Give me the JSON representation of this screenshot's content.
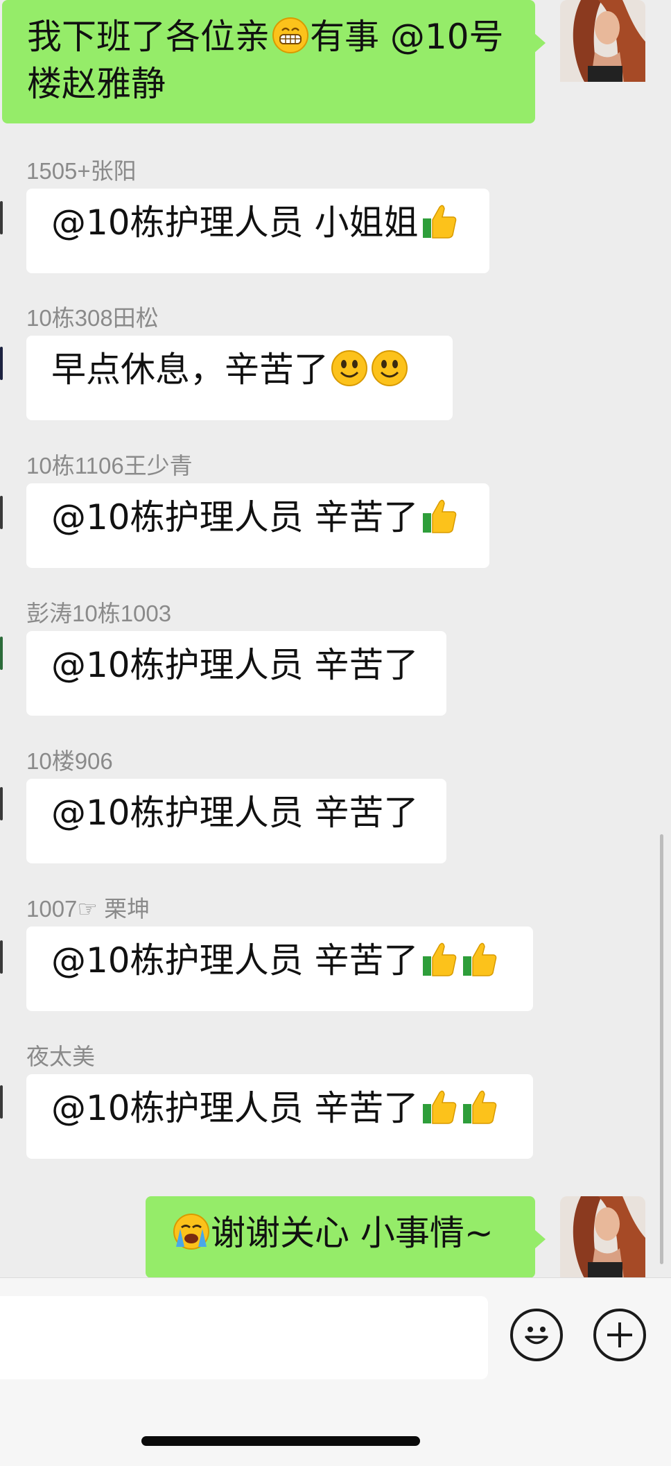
{
  "messages": [
    {
      "side": "out",
      "text": "我下班了各位亲",
      "emoji": "grinning-face",
      "text2": "有事 @10号",
      "line2": "楼赵雅静"
    },
    {
      "side": "in",
      "sender": "1505+张阳",
      "text": "@10栋护理人员 小姐姐",
      "emojis": [
        "thumbs-up"
      ]
    },
    {
      "side": "in",
      "sender": "10栋308田松",
      "text": "早点休息，辛苦了",
      "emojis": [
        "smiley",
        "smiley"
      ]
    },
    {
      "side": "in",
      "sender": "10栋1106王少青",
      "text": "@10栋护理人员 辛苦了",
      "emojis": [
        "thumbs-up"
      ]
    },
    {
      "side": "in",
      "sender": "彭涛10栋1003",
      "text": "@10栋护理人员 辛苦了",
      "emojis": []
    },
    {
      "side": "in",
      "sender": "10楼906",
      "text": "@10栋护理人员 辛苦了",
      "emojis": []
    },
    {
      "side": "in",
      "sender": "1007☞ 栗坤",
      "text": "@10栋护理人员 辛苦了",
      "emojis": [
        "thumbs-up",
        "thumbs-up"
      ]
    },
    {
      "side": "in",
      "sender": "夜太美",
      "text": "@10栋护理人员 辛苦了",
      "emojis": [
        "thumbs-up",
        "thumbs-up"
      ]
    },
    {
      "side": "out",
      "emoji": "loudly-crying-face",
      "text": "谢谢关心 小事情~"
    }
  ],
  "colors": {
    "out_bubble": "#95ec69",
    "in_bubble": "#ffffff",
    "background": "#ededed"
  },
  "icons": {
    "emoji_button": "smiley-icon",
    "more_button": "plus-circle-icon"
  }
}
